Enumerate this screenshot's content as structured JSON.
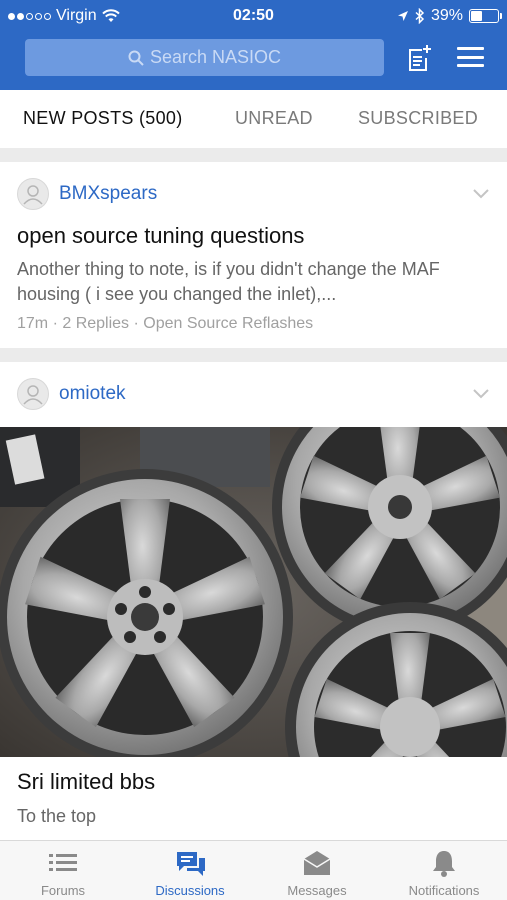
{
  "status_bar": {
    "carrier": "Virgin",
    "time": "02:50",
    "battery": "39%",
    "battery_level": 0.39
  },
  "header": {
    "search_placeholder": "Search NASIOC"
  },
  "tabs": [
    {
      "label": "NEW POSTS (500)"
    },
    {
      "label": "UNREAD"
    },
    {
      "label": "SUBSCRIBED"
    }
  ],
  "posts": [
    {
      "author": "BMXspears",
      "title": "open source tuning questions",
      "snippet": "Another thing to note, is if you didn't change the MAF housing ( i see you changed the inlet),...",
      "meta": "17m · 2 Replies · Open Source Reflashes"
    },
    {
      "author": "omiotek",
      "title": "Sri limited bbs",
      "snippet": "To the top"
    }
  ],
  "bottom_tabs": [
    {
      "label": "Forums",
      "icon": "list-icon"
    },
    {
      "label": "Discussions",
      "icon": "chat-bubbles-icon"
    },
    {
      "label": "Messages",
      "icon": "envelope-icon"
    },
    {
      "label": "Notifications",
      "icon": "bell-icon"
    }
  ],
  "colors": {
    "brand_blue": "#2d69c5",
    "search_bg": "#6d9ae0",
    "author_link": "#2d69c5"
  }
}
